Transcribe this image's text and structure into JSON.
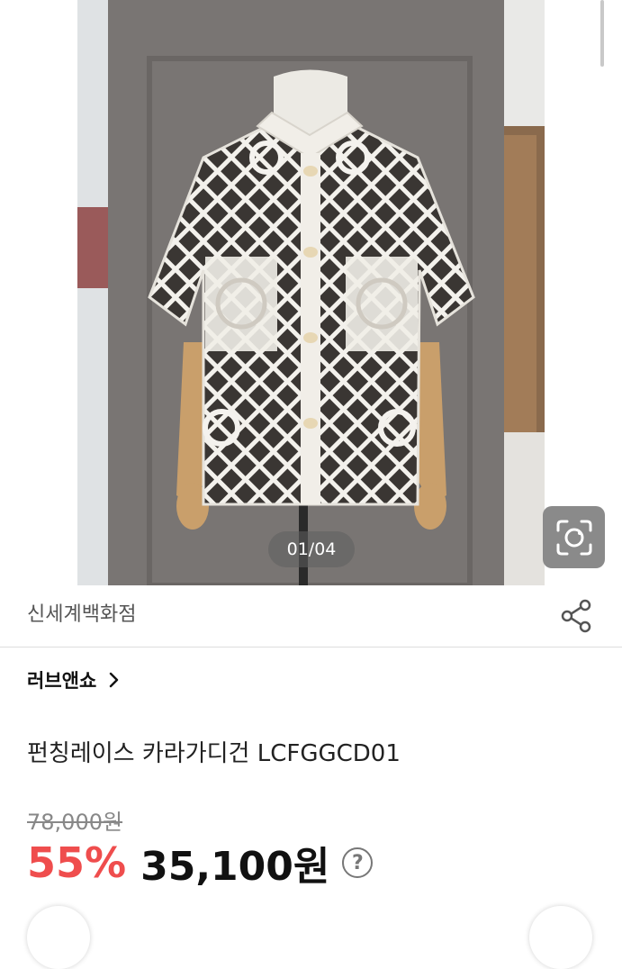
{
  "gallery": {
    "page_indicator": "01/04",
    "current_page": 1,
    "total_pages": 4
  },
  "store": {
    "name": "신세계백화점",
    "share_icon": "share-icon"
  },
  "brand": {
    "name": "러브앤쇼",
    "chevron": "›"
  },
  "product": {
    "name": "펀칭레이스 카라가디건 LCFGGCD01",
    "original_price": "78,000원",
    "discount": "55%",
    "sale_price": "35,100원",
    "help_symbol": "?"
  },
  "colors": {
    "discount": "#ef4d4d",
    "text": "#111111",
    "muted": "#888888"
  }
}
